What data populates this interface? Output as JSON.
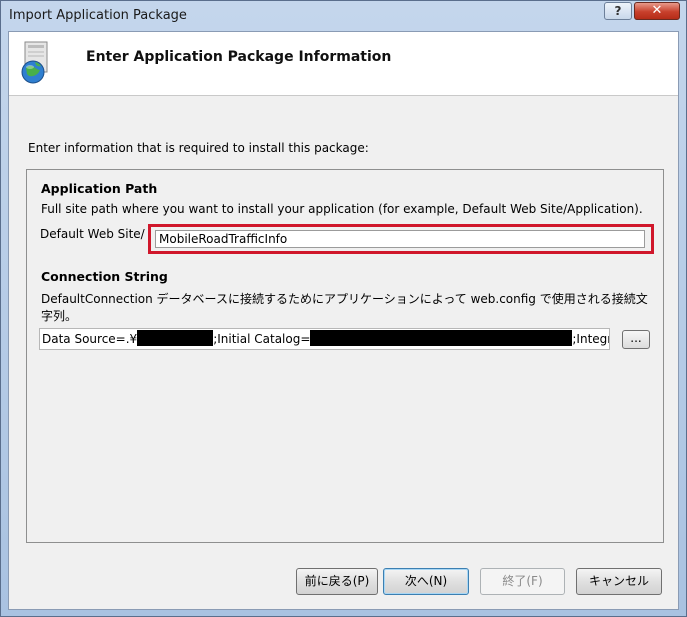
{
  "window": {
    "title": "Import Application Package",
    "help_label": "?",
    "close_label": "✕"
  },
  "header": {
    "title": "Enter Application Package Information",
    "icon": "package-globe-icon"
  },
  "intro_text": "Enter information that is required to install this package:",
  "application_path": {
    "section_title": "Application Path",
    "description": "Full site path where you want to install your application (for example, Default Web Site/Application).",
    "prefix_label": "Default Web Site/",
    "value": "MobileRoadTrafficInfo",
    "highlight_color": "#d0172b"
  },
  "connection_string": {
    "section_title": "Connection String",
    "description": "DefaultConnection データベースに接続するためにアプリケーションによって web.config で使用される接続文字列。",
    "parts": [
      "Data Source=.¥",
      ";Initial Catalog=",
      ";Integra"
    ],
    "browse_label": "..."
  },
  "buttons": {
    "back": "前に戻る(P)",
    "next": "次へ(N)",
    "finish": "終了(F)",
    "cancel": "キャンセル"
  }
}
